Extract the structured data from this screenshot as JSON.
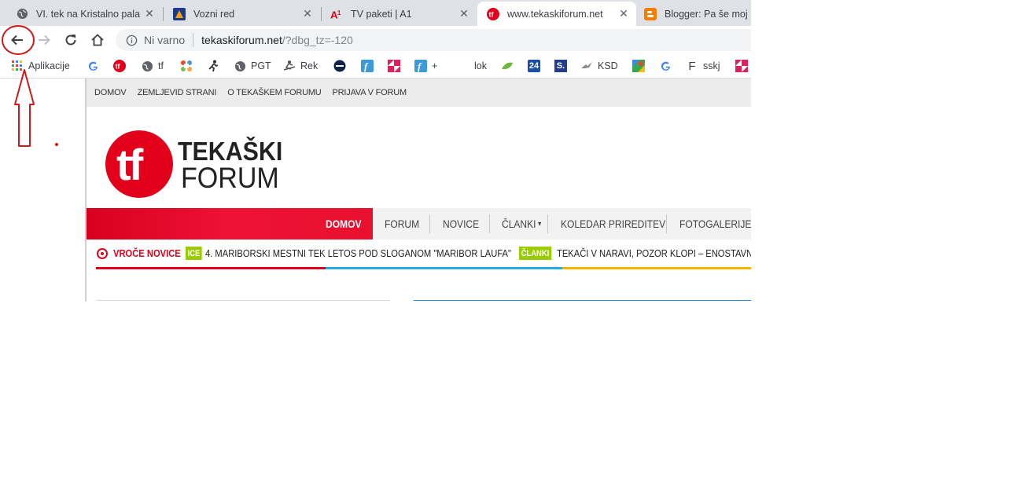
{
  "tabs": [
    {
      "title": "VI. tek na Kristalno pala",
      "icon": "globe-icon"
    },
    {
      "title": "Vozni red",
      "icon": "arriva-icon"
    },
    {
      "title": "TV paketi | A1",
      "icon": "a1-icon"
    },
    {
      "title": "www.tekaskiforum.net",
      "icon": "tf-icon",
      "active": true
    },
    {
      "title": "Blogger: Pa še moj ...",
      "icon": "blogger-icon"
    }
  ],
  "address": {
    "security": "Ni varno",
    "host": "tekaskiforum.net",
    "path": "/?dbg_tz=-120"
  },
  "bookmarks": {
    "apps": "Aplikacije",
    "items": [
      "tf",
      "PGT",
      "Rek",
      "+",
      "lok",
      "24",
      "S.",
      "KSD",
      "sskj"
    ]
  },
  "site": {
    "topnav": [
      "DOMOV",
      "ZEMLJEVID STRANI",
      "O TEKAŠKEM FORUMU",
      "PRIJAVA V FORUM"
    ],
    "logo_mark": "tf",
    "logo_line1": "TEKAŠKI",
    "logo_line2": "FORUM",
    "mainnav": [
      "DOMOV",
      "FORUM",
      "NOVICE",
      "ČLANKI",
      "KOLEDAR PRIREDITEV",
      "FOTOGALERIJE"
    ],
    "mainnav_caret": "▾",
    "hot_label": "VROČE NOVICE",
    "ticker": [
      {
        "tag": "ICE",
        "text": "4. MARIBORSKI MESTNI TEK LETOS POD SLOGANOM \"MARIBOR LAUFA\""
      },
      {
        "tag": "ČLANKI",
        "text": "TEKAČI V NARAVI, POZOR KLOPI – ENOSTAVNI UK"
      }
    ]
  },
  "colors": {
    "brand_red": "#e2001a",
    "tag_green": "#9acd00",
    "bar_blue": "#29abe2",
    "bar_yellow": "#f7b500",
    "annotation_red": "#d11919"
  }
}
